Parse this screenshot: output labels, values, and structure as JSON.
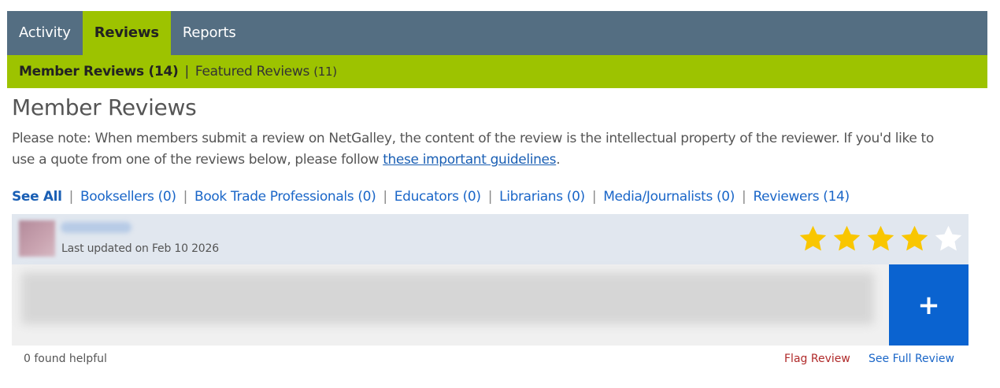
{
  "tabs": [
    {
      "label": "Activity"
    },
    {
      "label": "Reviews"
    },
    {
      "label": "Reports"
    }
  ],
  "subnav": {
    "member_label": "Member Reviews",
    "member_count": "(14)",
    "separator": "|",
    "featured_label": "Featured Reviews",
    "featured_count": "(11)"
  },
  "page": {
    "title": "Member Reviews",
    "note_text": "Please note: When members submit a review on NetGalley, the content of the review is the intellectual property of the reviewer. If you'd like to use a quote from one of the reviews below, please follow ",
    "note_link": "these important guidelines",
    "note_end": "."
  },
  "filters": [
    {
      "label": "See All"
    },
    {
      "label": "Booksellers (0)"
    },
    {
      "label": "Book Trade Professionals (0)"
    },
    {
      "label": "Educators (0)"
    },
    {
      "label": "Librarians (0)"
    },
    {
      "label": "Media/Journalists (0)"
    },
    {
      "label": "Reviewers (14)"
    }
  ],
  "review": {
    "updated": "Last updated on Feb 10 2026",
    "rating": 4,
    "rating_max": 5,
    "expand_label": "+",
    "helpful": "0 found helpful",
    "flag_label": "Flag Review",
    "full_label": "See Full Review"
  },
  "colors": {
    "tab_bar": "#546e82",
    "accent_green": "#9dc300",
    "star_filled": "#f9c600",
    "link_blue": "#1a66c8",
    "expand_button": "#0a63d0",
    "flag_red": "#b02a2a"
  }
}
